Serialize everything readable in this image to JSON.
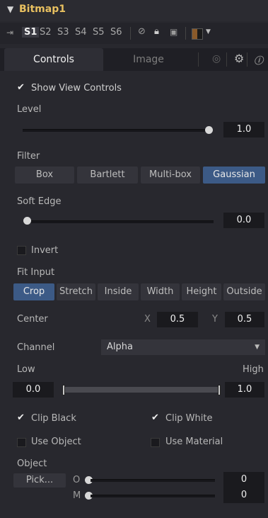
{
  "header": {
    "title": "Bitmap1"
  },
  "versions": {
    "items": [
      "S1",
      "S2",
      "S3",
      "S4",
      "S5",
      "S6"
    ],
    "active_index": 0
  },
  "tabs": {
    "controls": "Controls",
    "image": "Image"
  },
  "controls": {
    "show_view_controls": "Show View Controls",
    "level_label": "Level",
    "level_value": "1.0",
    "filter_label": "Filter",
    "filter_options": [
      "Box",
      "Bartlett",
      "Multi-box",
      "Gaussian"
    ],
    "filter_selected": "Gaussian",
    "soft_edge_label": "Soft Edge",
    "soft_edge_value": "0.0",
    "invert_label": "Invert",
    "fit_input_label": "Fit Input",
    "fit_options": [
      "Crop",
      "Stretch",
      "Inside",
      "Width",
      "Height",
      "Outside"
    ],
    "fit_selected": "Crop",
    "center_label": "Center",
    "center_x_label": "X",
    "center_x": "0.5",
    "center_y_label": "Y",
    "center_y": "0.5",
    "channel_label": "Channel",
    "channel_value": "Alpha",
    "low_label": "Low",
    "high_label": "High",
    "low_value": "0.0",
    "high_value": "1.0",
    "clip_black": "Clip Black",
    "clip_white": "Clip White",
    "use_object": "Use Object",
    "use_material": "Use Material",
    "object_label": "Object",
    "pick_button": "Pick...",
    "o_label": "O",
    "m_label": "M",
    "o_value": "0",
    "m_value": "0"
  }
}
